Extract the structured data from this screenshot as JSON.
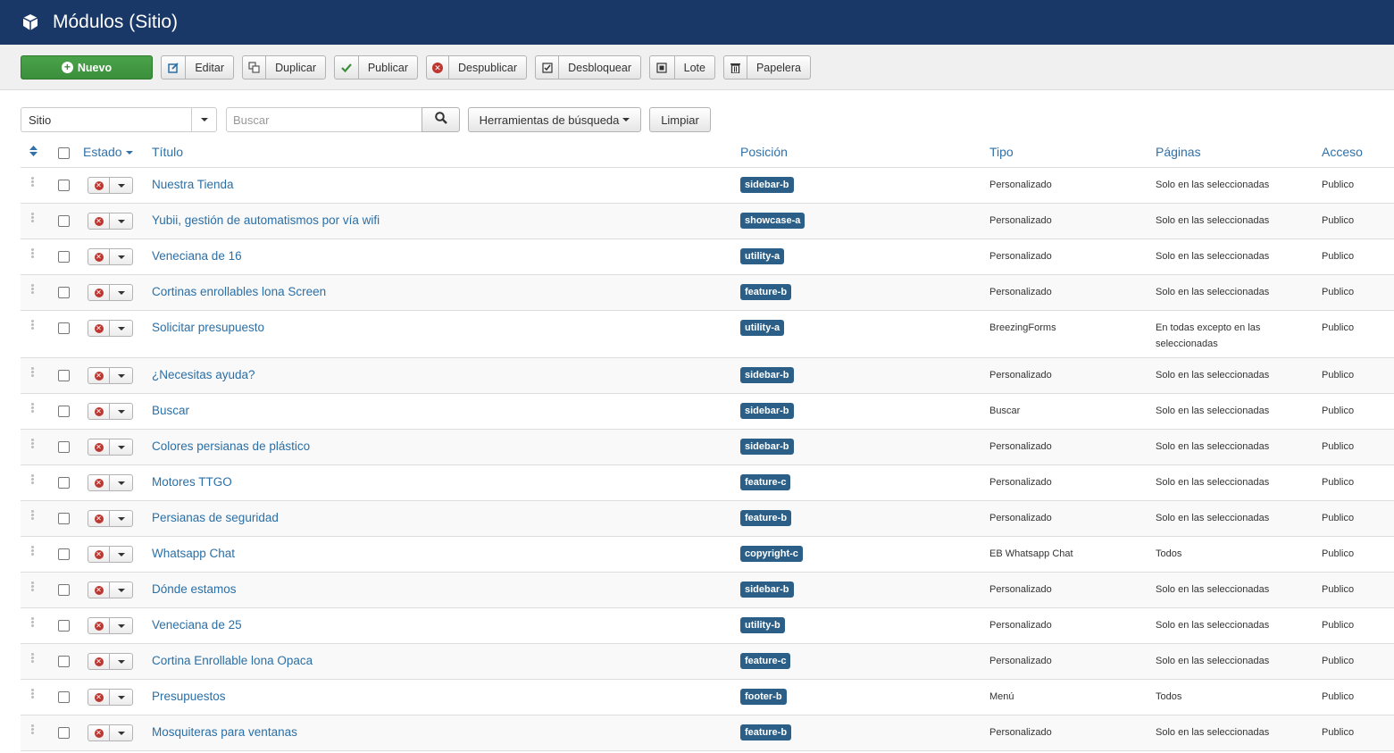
{
  "header": {
    "title": "Módulos (Sitio)"
  },
  "toolbar": {
    "new": "Nuevo",
    "edit": "Editar",
    "duplicate": "Duplicar",
    "publish": "Publicar",
    "unpublish": "Despublicar",
    "unlock": "Desbloquear",
    "batch": "Lote",
    "trash": "Papelera"
  },
  "filters": {
    "client": "Sitio",
    "search_placeholder": "Buscar",
    "search_tools": "Herramientas de búsqueda",
    "clear": "Limpiar"
  },
  "columns": {
    "status": "Estado",
    "title": "Título",
    "position": "Posición",
    "type": "Tipo",
    "pages": "Páginas",
    "access": "Acceso"
  },
  "rows": [
    {
      "title": "Nuestra Tienda",
      "position": "sidebar-b",
      "type": "Personalizado",
      "pages": "Solo en las seleccionadas",
      "access": "Publico"
    },
    {
      "title": "Yubii, gestión de automatismos por vía wifi",
      "position": "showcase-a",
      "type": "Personalizado",
      "pages": "Solo en las seleccionadas",
      "access": "Publico"
    },
    {
      "title": "Veneciana de 16",
      "position": "utility-a",
      "type": "Personalizado",
      "pages": "Solo en las seleccionadas",
      "access": "Publico"
    },
    {
      "title": "Cortinas enrollables lona Screen",
      "position": "feature-b",
      "type": "Personalizado",
      "pages": "Solo en las seleccionadas",
      "access": "Publico"
    },
    {
      "title": "Solicitar presupuesto",
      "position": "utility-a",
      "type": "BreezingForms",
      "pages": "En todas excepto en las seleccionadas",
      "access": "Publico"
    },
    {
      "title": "¿Necesitas ayuda?",
      "position": "sidebar-b",
      "type": "Personalizado",
      "pages": "Solo en las seleccionadas",
      "access": "Publico"
    },
    {
      "title": "Buscar",
      "position": "sidebar-b",
      "type": "Buscar",
      "pages": "Solo en las seleccionadas",
      "access": "Publico"
    },
    {
      "title": "Colores persianas de plástico",
      "position": "sidebar-b",
      "type": "Personalizado",
      "pages": "Solo en las seleccionadas",
      "access": "Publico"
    },
    {
      "title": "Motores TTGO",
      "position": "feature-c",
      "type": "Personalizado",
      "pages": "Solo en las seleccionadas",
      "access": "Publico"
    },
    {
      "title": "Persianas de seguridad",
      "position": "feature-b",
      "type": "Personalizado",
      "pages": "Solo en las seleccionadas",
      "access": "Publico"
    },
    {
      "title": "Whatsapp Chat",
      "position": "copyright-c",
      "type": "EB Whatsapp Chat",
      "pages": "Todos",
      "access": "Publico"
    },
    {
      "title": "Dónde estamos",
      "position": "sidebar-b",
      "type": "Personalizado",
      "pages": "Solo en las seleccionadas",
      "access": "Publico"
    },
    {
      "title": "Veneciana de 25",
      "position": "utility-b",
      "type": "Personalizado",
      "pages": "Solo en las seleccionadas",
      "access": "Publico"
    },
    {
      "title": "Cortina Enrollable lona Opaca",
      "position": "feature-c",
      "type": "Personalizado",
      "pages": "Solo en las seleccionadas",
      "access": "Publico"
    },
    {
      "title": "Presupuestos",
      "position": "footer-b",
      "type": "Menú",
      "pages": "Todos",
      "access": "Publico"
    },
    {
      "title": "Mosquiteras para ventanas",
      "position": "feature-b",
      "type": "Personalizado",
      "pages": "Solo en las seleccionadas",
      "access": "Publico"
    }
  ],
  "colors": {
    "header_bg": "#1a3867",
    "badge_bg": "#2b5f87",
    "link": "#2a6fa6",
    "new_button": "#3b8f3b",
    "unpublished_icon": "#bd362f"
  }
}
